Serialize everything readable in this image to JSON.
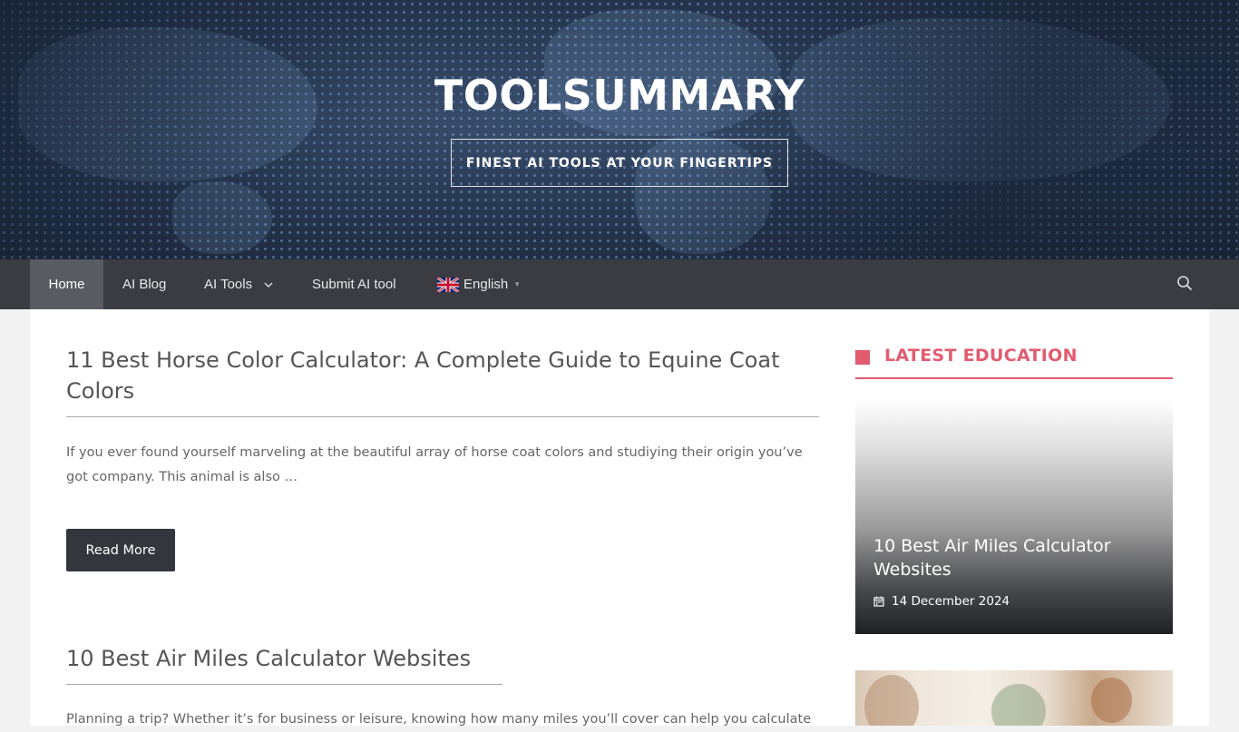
{
  "header": {
    "site_title": "TOOLSUMMARY",
    "tagline": "FINEST AI TOOLS AT YOUR FINGERTIPS"
  },
  "nav": {
    "items": [
      {
        "label": "Home"
      },
      {
        "label": "AI Blog"
      },
      {
        "label": "AI Tools"
      },
      {
        "label": "Submit AI tool"
      },
      {
        "label": "English"
      }
    ],
    "search_icon": "search-icon",
    "colors": {
      "bar": "#3a3c42",
      "active": "#595b63"
    }
  },
  "posts": [
    {
      "title": "11 Best Horse Color Calculator: A Complete Guide to Equine Coat Colors",
      "excerpt": "If you ever found yourself marveling at the beautiful array of horse coat colors and studiying their origin you’ve got company. This animal is also …",
      "read_more": "Read More"
    },
    {
      "title": "10 Best Air Miles Calculator Websites",
      "excerpt": "Planning a trip? Whether it’s for business or leisure, knowing how many miles you’ll cover can help you calculate"
    }
  ],
  "sidebar": {
    "widget_title": "LATEST EDUCATION",
    "accent": "#e25c6f",
    "items": [
      {
        "title": "10 Best Air Miles Calculator Websites",
        "date": "14 December 2024"
      }
    ]
  }
}
